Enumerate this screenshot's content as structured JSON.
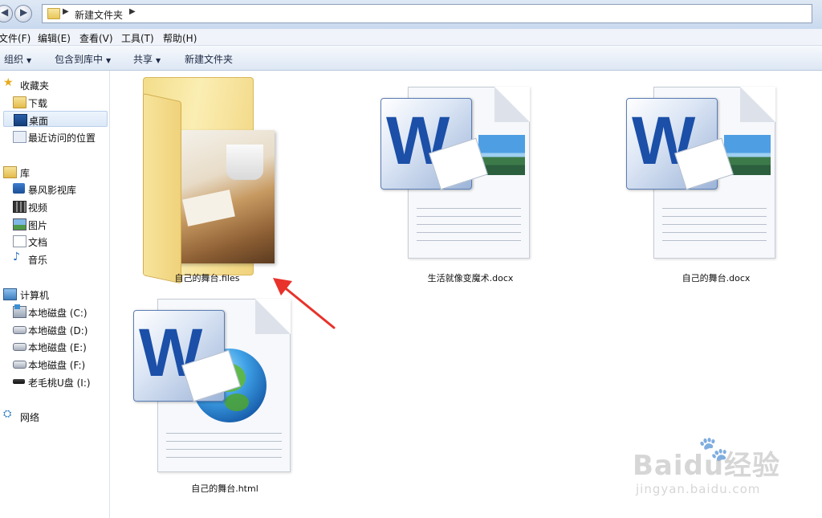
{
  "address": {
    "back_icon": "back-arrow-icon",
    "forward_icon": "forward-arrow-icon",
    "breadcrumb": "新建文件夹"
  },
  "menu": {
    "items": [
      "文件(F)",
      "编辑(E)",
      "查看(V)",
      "工具(T)",
      "帮助(H)"
    ]
  },
  "toolbar": {
    "organize": "组织",
    "include_library": "包含到库中",
    "share": "共享",
    "new_folder": "新建文件夹"
  },
  "nav": {
    "favorites": {
      "label": "收藏夹",
      "items": [
        {
          "label": "下载",
          "icon": "download-folder-icon"
        },
        {
          "label": "桌面",
          "icon": "desktop-icon",
          "selected": true
        },
        {
          "label": "最近访问的位置",
          "icon": "recent-places-icon"
        }
      ]
    },
    "libraries": {
      "label": "库",
      "items": [
        {
          "label": "暴风影视库",
          "icon": "media-library-icon"
        },
        {
          "label": "视频",
          "icon": "video-icon"
        },
        {
          "label": "图片",
          "icon": "pictures-icon"
        },
        {
          "label": "文档",
          "icon": "documents-icon"
        },
        {
          "label": "音乐",
          "icon": "music-icon"
        }
      ]
    },
    "computer": {
      "label": "计算机",
      "items": [
        {
          "label": "本地磁盘 (C:)",
          "icon": "system-drive-icon"
        },
        {
          "label": "本地磁盘 (D:)",
          "icon": "hard-drive-icon"
        },
        {
          "label": "本地磁盘 (E:)",
          "icon": "hard-drive-icon"
        },
        {
          "label": "本地磁盘 (F:)",
          "icon": "hard-drive-icon"
        },
        {
          "label": "老毛桃U盘 (I:)",
          "icon": "usb-drive-icon"
        }
      ]
    },
    "network": {
      "label": "网络"
    }
  },
  "files": [
    {
      "name": "自己的舞台.files",
      "type": "folder",
      "icon": "folder-icon"
    },
    {
      "name": "生活就像变魔术.docx",
      "type": "docx",
      "icon": "word-document-icon"
    },
    {
      "name": "自己的舞台.docx",
      "type": "docx",
      "icon": "word-document-icon"
    },
    {
      "name": "自己的舞台.html",
      "type": "html",
      "icon": "word-html-document-icon"
    }
  ],
  "colors": {
    "annotation_arrow": "#e8322b",
    "word_blue": "#1b4fa8",
    "selection": "#dbe8f8"
  },
  "watermark": {
    "main": "Baidu经验",
    "sub": "jingyan.baidu.com"
  }
}
